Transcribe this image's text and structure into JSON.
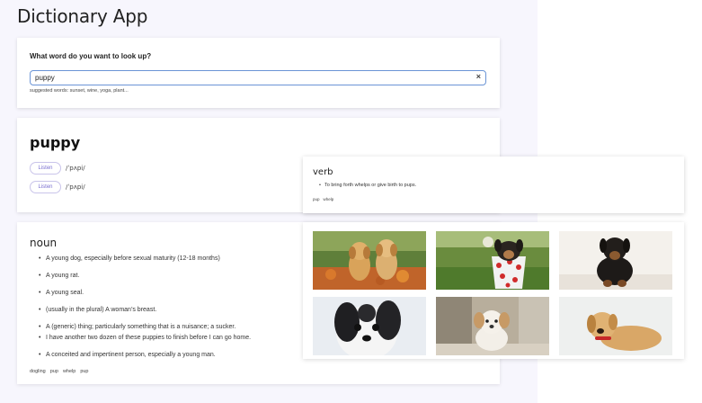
{
  "app": {
    "title": "Dictionary App"
  },
  "search": {
    "question": "What word do you want to look up?",
    "value": "puppy",
    "placeholder": "",
    "clear_label": "×",
    "suggested": "suggested words: sunset, wine, yoga, plant..."
  },
  "word": {
    "title": "puppy",
    "phonetics": [
      {
        "listen_label": "Listen",
        "text": "/ˈpʌpi/"
      },
      {
        "listen_label": "Listen",
        "text": "/ˈpʌpi/"
      }
    ]
  },
  "meanings": {
    "noun": {
      "part_of_speech": "noun",
      "definitions": [
        "A young dog, especially before sexual maturity (12-18 months)",
        "A young rat.",
        "A young seal.",
        "(usually in the plural) A woman’s breast.",
        "A (generic) thing; particularly something that is a nuisance; a sucker.",
        "I have another two dozen of these puppies to finish before I can go home.",
        "A conceited and impertinent person, especially a young man."
      ],
      "synonyms": [
        "dogling",
        "pup",
        "whelp",
        "pup"
      ]
    },
    "verb": {
      "part_of_speech": "verb",
      "definitions": [
        "To bring forth whelps or give birth to pups."
      ],
      "synonyms": [
        "pup",
        "whelp"
      ]
    }
  },
  "images": {
    "items": [
      {
        "name": "two-golden-puppies-image"
      },
      {
        "name": "puppy-in-polka-dot-cup-image"
      },
      {
        "name": "black-puppy-image"
      },
      {
        "name": "black-white-fluffy-puppy-image"
      },
      {
        "name": "small-white-puppy-image"
      },
      {
        "name": "golden-puppy-lying-image"
      }
    ]
  },
  "colors": {
    "accent": "#7a6fd0",
    "input_border": "#6b95d6",
    "app_background": "#f7f6fd"
  }
}
